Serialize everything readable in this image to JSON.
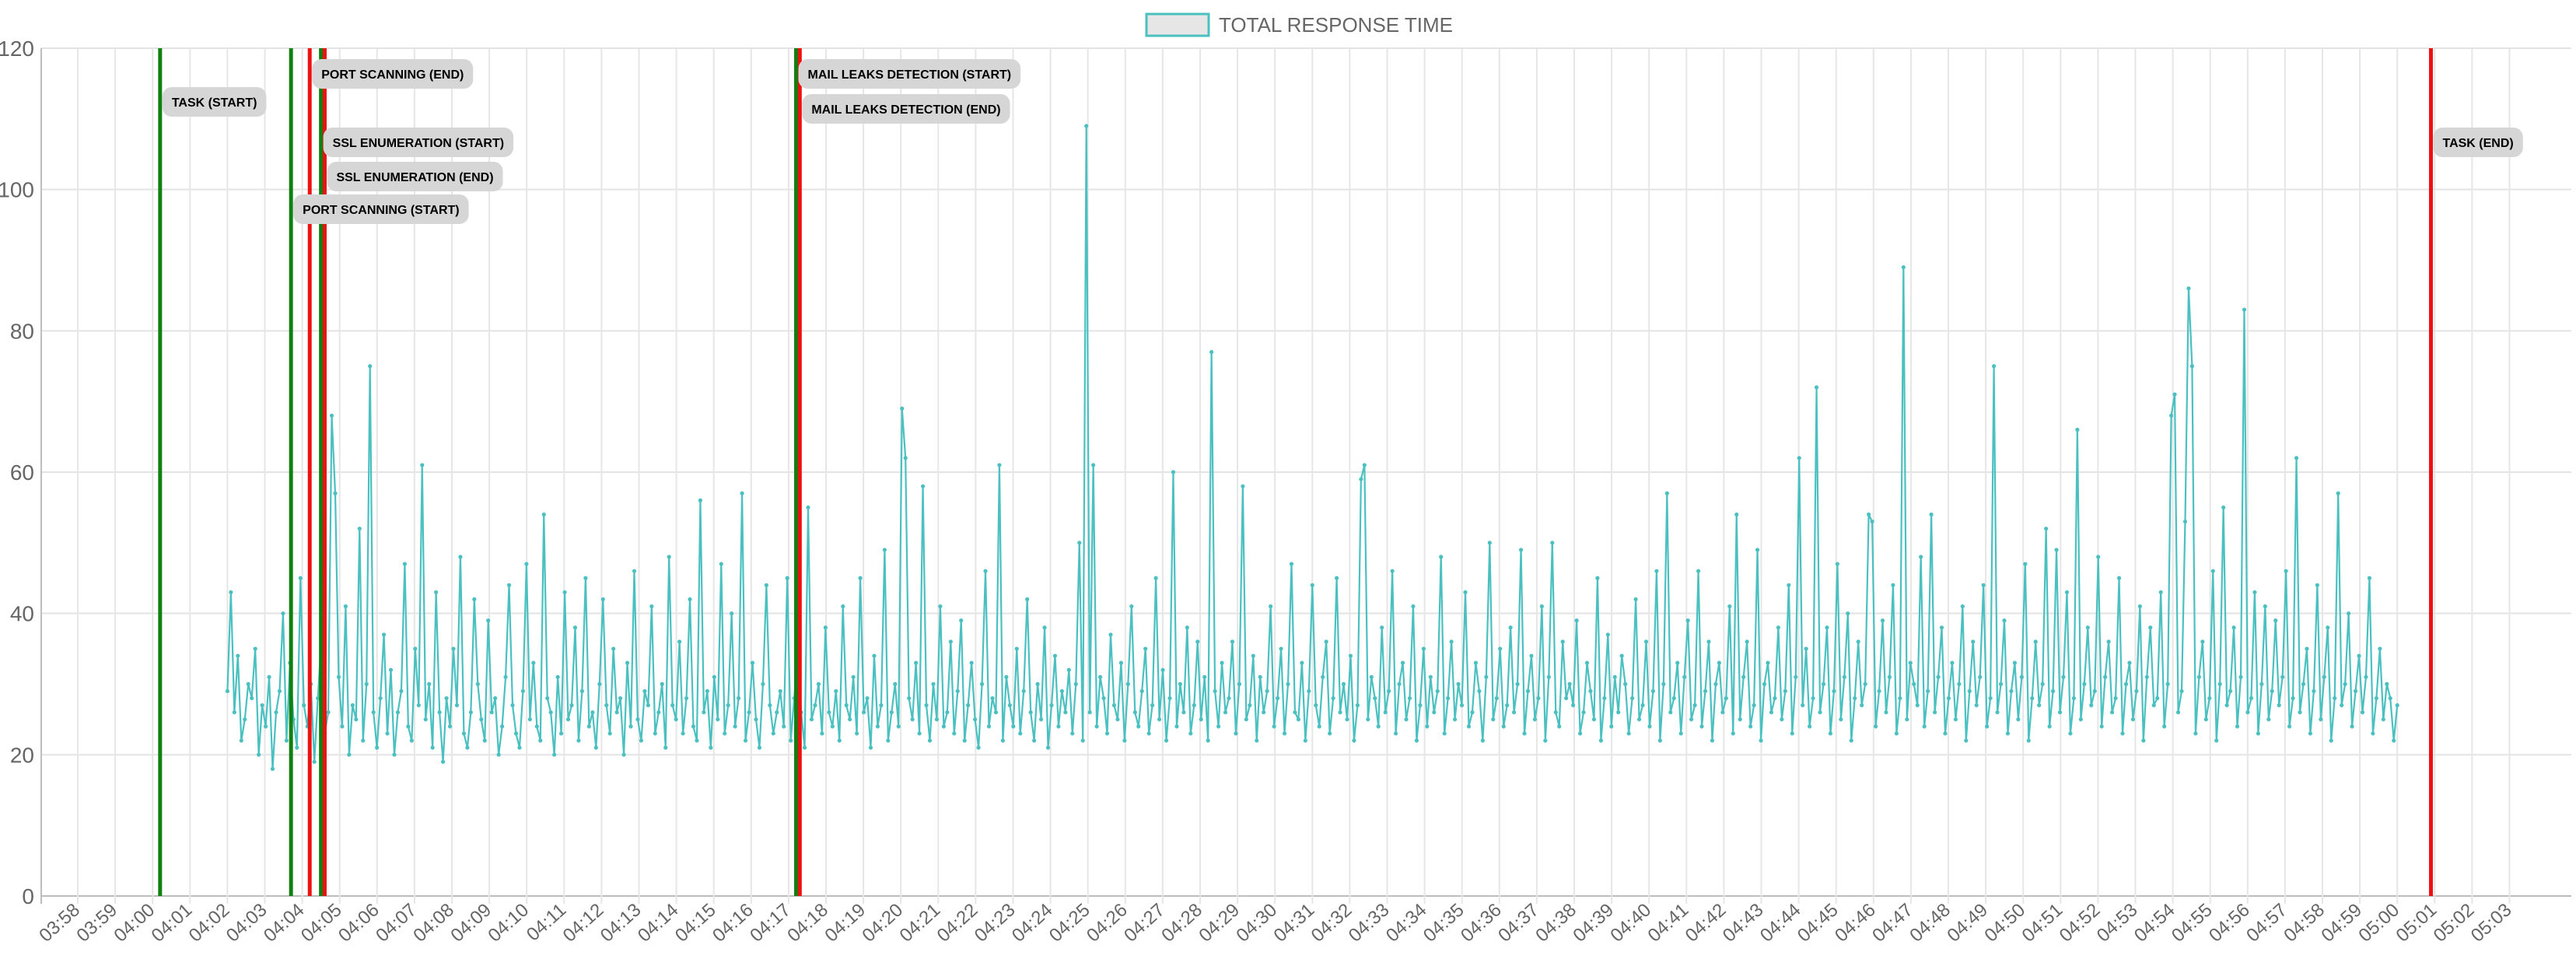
{
  "chart_data": {
    "type": "line",
    "title": "",
    "xlabel": "",
    "ylabel": "",
    "legend": {
      "position": "top-center",
      "entries": [
        "TOTAL RESPONSE TIME"
      ]
    },
    "grid": true,
    "ylim": [
      0,
      120
    ],
    "y_ticks": [
      0,
      20,
      40,
      60,
      80,
      100,
      120
    ],
    "x_ticks": [
      "03:58",
      "03:59",
      "04:00",
      "04:01",
      "04:02",
      "04:03",
      "04:04",
      "04:05",
      "04:06",
      "04:07",
      "04:08",
      "04:09",
      "04:10",
      "04:11",
      "04:12",
      "04:13",
      "04:14",
      "04:15",
      "04:16",
      "04:17",
      "04:18",
      "04:19",
      "04:20",
      "04:21",
      "04:22",
      "04:23",
      "04:24",
      "04:25",
      "04:26",
      "04:27",
      "04:28",
      "04:29",
      "04:30",
      "04:31",
      "04:32",
      "04:33",
      "04:34",
      "04:35",
      "04:36",
      "04:37",
      "04:38",
      "04:39",
      "04:40",
      "04:41",
      "04:42",
      "04:43",
      "04:44",
      "04:45",
      "04:46",
      "04:47",
      "04:48",
      "04:49",
      "04:50",
      "04:51",
      "04:52",
      "04:53",
      "04:54",
      "04:55",
      "04:56",
      "04:57",
      "04:58",
      "04:59",
      "05:00",
      "05:01",
      "05:02",
      "05:03"
    ],
    "series": [
      {
        "name": "TOTAL RESPONSE TIME",
        "color": "#4bc0c0",
        "fill_color": "#e6e6e6",
        "x_start": "04:02",
        "x_end": "05:00",
        "values": [
          29,
          43,
          26,
          34,
          22,
          25,
          30,
          28,
          35,
          20,
          27,
          24,
          31,
          18,
          26,
          29,
          40,
          22,
          33,
          25,
          21,
          45,
          27,
          24,
          30,
          19,
          28,
          36,
          23,
          26,
          68,
          57,
          31,
          24,
          41,
          20,
          27,
          25,
          52,
          22,
          30,
          75,
          26,
          21,
          28,
          37,
          23,
          32,
          20,
          26,
          29,
          47,
          24,
          22,
          35,
          27,
          61,
          25,
          30,
          21,
          43,
          26,
          19,
          28,
          24,
          35,
          27,
          48,
          23,
          21,
          26,
          42,
          30,
          25,
          22,
          39,
          26,
          28,
          20,
          24,
          31,
          44,
          27,
          23,
          21,
          29,
          47,
          25,
          33,
          24,
          22,
          54,
          28,
          26,
          20,
          31,
          23,
          43,
          25,
          27,
          38,
          22,
          29,
          45,
          24,
          26,
          21,
          30,
          42,
          27,
          23,
          35,
          26,
          28,
          20,
          33,
          24,
          46,
          25,
          22,
          29,
          27,
          41,
          23,
          26,
          30,
          21,
          48,
          27,
          25,
          36,
          23,
          28,
          42,
          24,
          22,
          56,
          26,
          29,
          21,
          31,
          25,
          47,
          23,
          27,
          40,
          24,
          28,
          57,
          22,
          26,
          33,
          25,
          21,
          30,
          44,
          27,
          23,
          26,
          29,
          24,
          45,
          22,
          28,
          35,
          26,
          21,
          55,
          25,
          27,
          30,
          23,
          38,
          26,
          24,
          29,
          22,
          41,
          27,
          25,
          31,
          23,
          45,
          26,
          28,
          21,
          34,
          24,
          27,
          49,
          22,
          26,
          30,
          24,
          69,
          62,
          28,
          25,
          33,
          23,
          58,
          27,
          22,
          30,
          25,
          41,
          24,
          26,
          36,
          23,
          29,
          39,
          22,
          27,
          33,
          25,
          21,
          30,
          46,
          24,
          28,
          26,
          61,
          22,
          31,
          27,
          24,
          35,
          23,
          29,
          42,
          26,
          22,
          30,
          25,
          38,
          21,
          27,
          34,
          24,
          29,
          26,
          32,
          23,
          30,
          50,
          22,
          109,
          26,
          61,
          24,
          31,
          28,
          23,
          37,
          27,
          25,
          33,
          22,
          30,
          41,
          26,
          24,
          29,
          35,
          23,
          27,
          45,
          25,
          32,
          22,
          28,
          60,
          24,
          30,
          26,
          38,
          23,
          27,
          36,
          25,
          31,
          22,
          77,
          29,
          24,
          33,
          26,
          28,
          36,
          23,
          30,
          58,
          25,
          27,
          34,
          22,
          31,
          26,
          29,
          41,
          24,
          28,
          35,
          23,
          30,
          47,
          26,
          25,
          33,
          22,
          29,
          44,
          27,
          24,
          31,
          36,
          23,
          28,
          45,
          26,
          30,
          25,
          34,
          22,
          27,
          59,
          61,
          25,
          31,
          28,
          24,
          38,
          26,
          29,
          46,
          23,
          30,
          33,
          25,
          28,
          41,
          22,
          27,
          35,
          24,
          31,
          26,
          29,
          48,
          23,
          28,
          36,
          25,
          30,
          27,
          43,
          24,
          26,
          33,
          29,
          22,
          31,
          50,
          25,
          28,
          35,
          24,
          27,
          38,
          26,
          30,
          49,
          23,
          29,
          34,
          25,
          28,
          41,
          22,
          31,
          50,
          26,
          24,
          36,
          28,
          30,
          27,
          39,
          23,
          26,
          33,
          29,
          25,
          45,
          22,
          28,
          37,
          24,
          31,
          26,
          34,
          30,
          23,
          28,
          42,
          25,
          27,
          36,
          24,
          29,
          46,
          22,
          30,
          57,
          26,
          28,
          33,
          23,
          31,
          39,
          25,
          27,
          46,
          24,
          29,
          36,
          22,
          30,
          33,
          26,
          28,
          41,
          23,
          54,
          25,
          31,
          36,
          24,
          27,
          49,
          22,
          30,
          33,
          26,
          28,
          38,
          25,
          29,
          44,
          23,
          31,
          62,
          27,
          35,
          24,
          28,
          72,
          26,
          30,
          38,
          23,
          29,
          47,
          25,
          31,
          40,
          22,
          28,
          36,
          27,
          30,
          54,
          53,
          24,
          29,
          39,
          26,
          31,
          44,
          23,
          28,
          89,
          25,
          33,
          30,
          27,
          48,
          24,
          29,
          54,
          26,
          31,
          38,
          23,
          28,
          33,
          25,
          30,
          41,
          22,
          29,
          36,
          27,
          31,
          44,
          24,
          28,
          75,
          26,
          30,
          39,
          23,
          29,
          33,
          25,
          31,
          47,
          22,
          28,
          36,
          27,
          30,
          52,
          24,
          29,
          49,
          26,
          31,
          43,
          23,
          28,
          66,
          25,
          30,
          38,
          27,
          29,
          48,
          24,
          31,
          36,
          26,
          28,
          45,
          23,
          30,
          33,
          25,
          29,
          41,
          22,
          31,
          38,
          27,
          28,
          43,
          24,
          30,
          68,
          71,
          26,
          29,
          53,
          86,
          75,
          23,
          31,
          36,
          25,
          28,
          46,
          22,
          30,
          55,
          27,
          29,
          38,
          24,
          31,
          83,
          26,
          28,
          43,
          23,
          30,
          41,
          25,
          29,
          39,
          27,
          31,
          46,
          24,
          28,
          62,
          26,
          30,
          35,
          23,
          29,
          44,
          25,
          31,
          38,
          22,
          28,
          57,
          27,
          30,
          40,
          24,
          29,
          34,
          26,
          31,
          45,
          23,
          28,
          35,
          25,
          30,
          28,
          22,
          27
        ]
      }
    ],
    "annotations": [
      {
        "label": "TASK (START)",
        "time": "04:00.2",
        "color": "green"
      },
      {
        "label": "PORT SCANNING (START)",
        "time": "04:03.7",
        "color": "green"
      },
      {
        "label": "PORT SCANNING (END)",
        "time": "04:04.2",
        "color": "red"
      },
      {
        "label": "SSL ENUMERATION (START)",
        "time": "04:04.5",
        "color": "green"
      },
      {
        "label": "SSL ENUMERATION (END)",
        "time": "04:04.6",
        "color": "red"
      },
      {
        "label": "MAIL LEAKS DETECTION (START)",
        "time": "04:17.2",
        "color": "green"
      },
      {
        "label": "MAIL LEAKS DETECTION (END)",
        "time": "04:17.3",
        "color": "red"
      },
      {
        "label": "TASK (END)",
        "time": "05:00.9",
        "color": "red"
      }
    ]
  }
}
